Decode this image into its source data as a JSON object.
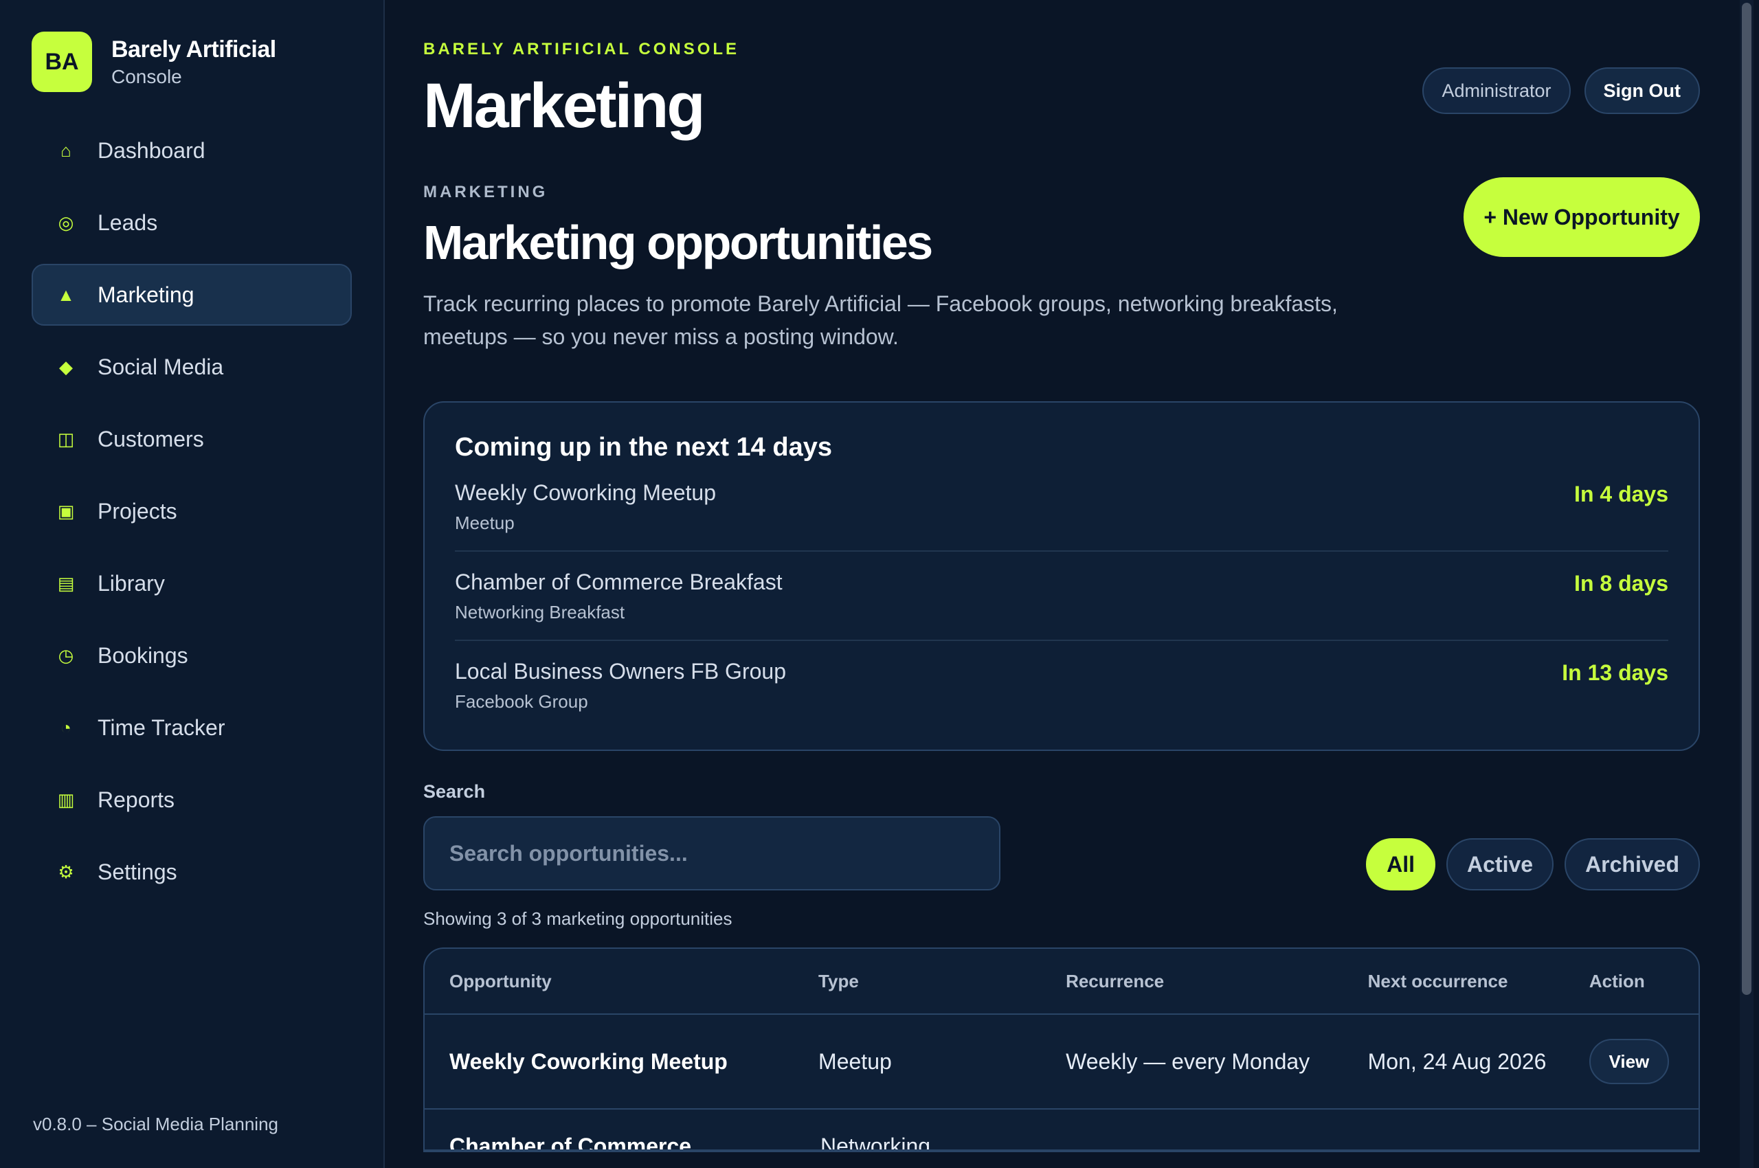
{
  "brand": {
    "initials": "BA",
    "name": "Barely Artificial",
    "sub": "Console"
  },
  "nav": [
    {
      "label": "Dashboard",
      "icon": "home-icon",
      "glyph": "⌂"
    },
    {
      "label": "Leads",
      "icon": "target-icon",
      "glyph": "◎"
    },
    {
      "label": "Marketing",
      "icon": "triangle-icon",
      "glyph": "▲",
      "active": true
    },
    {
      "label": "Social Media",
      "icon": "diamond-icon",
      "glyph": "◆"
    },
    {
      "label": "Customers",
      "icon": "columns-icon",
      "glyph": "◫"
    },
    {
      "label": "Projects",
      "icon": "square-icon",
      "glyph": "▣"
    },
    {
      "label": "Library",
      "icon": "stack-icon",
      "glyph": "▤"
    },
    {
      "label": "Bookings",
      "icon": "clock-icon",
      "glyph": "◷"
    },
    {
      "label": "Time Tracker",
      "icon": "timer-icon",
      "glyph": "◔"
    },
    {
      "label": "Reports",
      "icon": "bars-icon",
      "glyph": "▥"
    },
    {
      "label": "Settings",
      "icon": "gear-icon",
      "glyph": "⚙"
    }
  ],
  "footer": "v0.8.0 – Social Media Planning",
  "header": {
    "eyebrow": "BARELY ARTIFICIAL CONSOLE",
    "title": "Marketing",
    "role_label": "Administrator",
    "signout_label": "Sign Out"
  },
  "section": {
    "eyebrow": "MARKETING",
    "title": "Marketing opportunities",
    "description": "Track recurring places to promote Barely Artificial — Facebook groups, networking breakfasts, meetups — so you never miss a posting window.",
    "new_button": "+ New Opportunity"
  },
  "upcoming": {
    "title": "Coming up in the next 14 days",
    "items": [
      {
        "name": "Weekly Coworking Meetup",
        "type": "Meetup",
        "when": "In 4 days"
      },
      {
        "name": "Chamber of Commerce Breakfast",
        "type": "Networking Breakfast",
        "when": "In 8 days"
      },
      {
        "name": "Local Business Owners FB Group",
        "type": "Facebook Group",
        "when": "In 13 days"
      }
    ]
  },
  "search": {
    "label": "Search",
    "placeholder": "Search opportunities...",
    "filters": [
      "All",
      "Active",
      "Archived"
    ],
    "active_filter": "All"
  },
  "count_text": "Showing 3 of 3 marketing opportunities",
  "table": {
    "columns": [
      "Opportunity",
      "Type",
      "Recurrence",
      "Next occurrence",
      "Action"
    ],
    "rows": [
      {
        "opportunity": "Weekly Coworking Meetup",
        "type": "Meetup",
        "recurrence": "Weekly — every Monday",
        "next": "Mon, 24 Aug 2026",
        "action": "View"
      },
      {
        "opportunity": "Chamber of Commerce",
        "type": "Networking",
        "recurrence": "",
        "next": "",
        "action": ""
      }
    ]
  },
  "colors": {
    "accent": "#c6ff3d",
    "background": "#0a1526",
    "panel": "#0e1f36",
    "border": "#2a4567"
  }
}
